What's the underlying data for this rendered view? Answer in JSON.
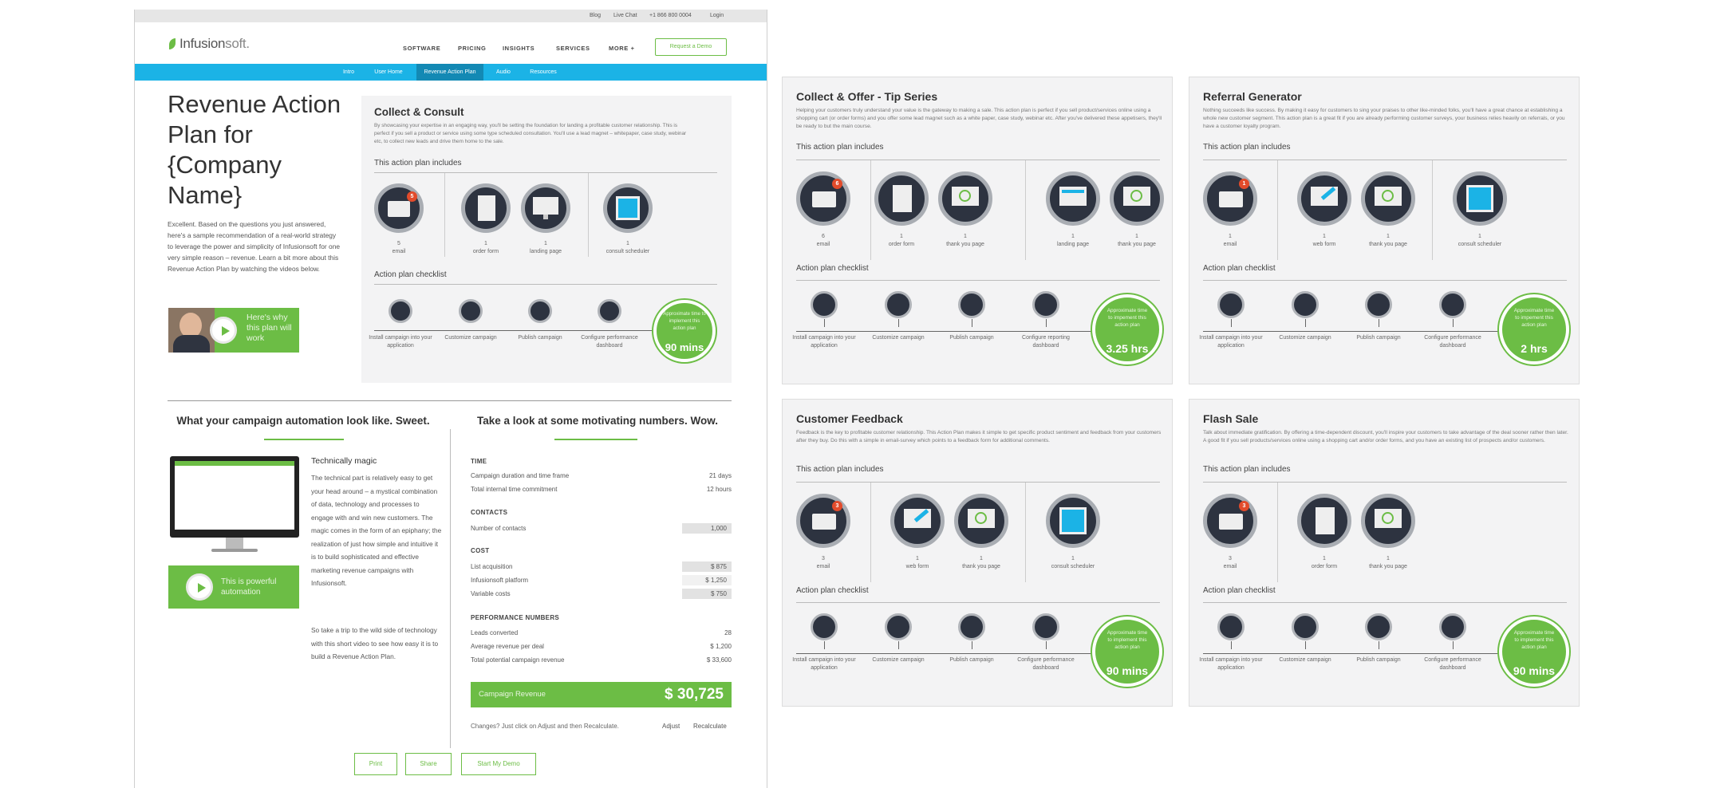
{
  "utility": {
    "blog": "Blog",
    "livechat": "Live Chat",
    "phone": "+1 866 800 0004",
    "login": "Login"
  },
  "brand": {
    "name_a": "Infusion",
    "name_b": "soft."
  },
  "nav": {
    "software": "SOFTWARE",
    "pricing": "PRICING",
    "insights": "INSIGHTS",
    "services": "SERVICES",
    "more": "MORE +",
    "demo": "Request a Demo"
  },
  "subnav": [
    "Intro",
    "User Home",
    "Revenue Action Plan",
    "Audio",
    "Resources"
  ],
  "page": {
    "title": "Revenue Action Plan for {Company Name}",
    "intro": "Excellent. Based on the questions you just answered, here's a sample recommendation of a real-world strategy to leverage the power and simplicity of Infusionsoft for one very simple reason – revenue. Learn a bit more about this Revenue Action Plan by watching the videos below.",
    "video1": "Here's why this plan will work",
    "video2": "This is powerful automation"
  },
  "collect_consult": {
    "title": "Collect & Consult",
    "desc": "By showcasing your expertise in an engaging way, you'll be setting the foundation for landing a profitable customer relationship. This is perfect if you sell a product or service using some type scheduled consultation. You'll use a lead magnet – whitepaper, case study, webinar etc, to collect new leads and drive them home to the sale.",
    "includes": "This action plan includes",
    "items": [
      {
        "count": "5",
        "label": "email",
        "badge": "5"
      },
      {
        "count": "1",
        "label": "order form"
      },
      {
        "count": "1",
        "label": "landing page"
      },
      {
        "count": "1",
        "label": "consult scheduler"
      }
    ],
    "checklist": "Action plan checklist",
    "steps": [
      "Install campaign into your application",
      "Customize campaign",
      "Publish campaign",
      "Configure performance dashboard"
    ],
    "time_label": "Approximate time to implement this action plan",
    "time": "90 mins"
  },
  "automation": {
    "heading": "What your campaign automation look like. Sweet.",
    "subtitle": "Technically magic",
    "p1": "The technical part is relatively easy to get your head around – a mystical combination of data, technology and processes to engage with and win new customers. The magic comes in the form of an epiphany; the realization of just how simple and intuitive it is to build sophisticated and effective marketing revenue campaigns with Infusionsoft.",
    "p2": "So take a trip to the wild side of technology with this short video to see how easy it is to build a Revenue Action Plan."
  },
  "numbers": {
    "heading": "Take a look at some motivating numbers. Wow.",
    "time_h": "TIME",
    "r1": "Campaign duration and time frame",
    "v1": "21 days",
    "r2": "Total internal time commitment",
    "v2": "12 hours",
    "contacts_h": "CONTACTS",
    "r3": "Number of contacts",
    "v3": "1,000",
    "cost_h": "COST",
    "r4": "List acquisition",
    "v4": "$ 875",
    "r5": "Infusionsoft platform",
    "v5": "$ 1,250",
    "r6": "Variable costs",
    "v6": "$ 750",
    "perf_h": "PERFORMANCE NUMBERS",
    "r7": "Leads converted",
    "v7": "28",
    "r8": "Average revenue per deal",
    "v8": "$ 1,200",
    "r9": "Total potential campaign revenue",
    "v9": "$ 33,600",
    "rev_label": "Campaign Revenue",
    "rev_value": "$ 30,725",
    "changes": "Changes? Just click on Adjust and then Recalculate.",
    "adjust": "Adjust",
    "recalc": "Recalculate"
  },
  "buttons": {
    "print": "Print",
    "share": "Share",
    "start": "Start My Demo"
  },
  "cards": [
    {
      "title": "Collect & Offer - Tip Series",
      "desc": "Helping your customers truly understand your value is the gateway to making a sale. This action plan is perfect if you sell product/services online using a shopping cart (or order forms) and you offer some lead magnet such as a white paper, case study, webinar etc. After you've delivered these appetisers, they'll be ready to but the main course.",
      "includes": "This action plan includes",
      "checklist": "Action plan checklist",
      "items": [
        {
          "count": "6",
          "label": "email"
        },
        {
          "count": "1",
          "label": "order form"
        },
        {
          "count": "1",
          "label": "thank you page"
        },
        {
          "count": "1",
          "label": "landing page"
        },
        {
          "count": "1",
          "label": "thank you page"
        }
      ],
      "steps": [
        "Install campaign into your application",
        "Customize campaign",
        "Publish campaign",
        "Configure reporting dashboard"
      ],
      "time_label": "Approximate time to impement this action plan",
      "time": "3.25 hrs"
    },
    {
      "title": "Referral Generator",
      "desc": "Nothing succeeds like success. By making it easy for customers to sing your praises to other like-minded folks, you'll have a great chance at establishing a whole new customer segment. This action plan is a great fit if you are already performing customer surveys, your business relies heavily on referrals, or you have a customer loyalty program.",
      "includes": "This action plan includes",
      "checklist": "Action plan checklist",
      "items": [
        {
          "count": "1",
          "label": "email"
        },
        {
          "count": "1",
          "label": "web form"
        },
        {
          "count": "1",
          "label": "thank you page"
        },
        {
          "count": "1",
          "label": "consult scheduler"
        }
      ],
      "steps": [
        "Install campaign into your application",
        "Customize campaign",
        "Publish campaign",
        "Configure performance dashboard"
      ],
      "time_label": "Approximate time to impement this action plan",
      "time": "2 hrs"
    },
    {
      "title": "Customer Feedback",
      "desc": "Feedback is the key to profitable customer relationship. This Action Plan makes it simple to get specific product sentiment and feedback from your customers after they buy. Do this with a simple in email-survey which points to a feedback form for additional comments.",
      "includes": "This action plan includes",
      "checklist": "Action plan checklist",
      "items": [
        {
          "count": "3",
          "label": "email"
        },
        {
          "count": "1",
          "label": "web form"
        },
        {
          "count": "1",
          "label": "thank you page"
        },
        {
          "count": "1",
          "label": "consult scheduler"
        }
      ],
      "steps": [
        "Install campaign into your application",
        "Customize campaign",
        "Publish campaign",
        "Configure performance dashboard"
      ],
      "time_label": "Approximate time to implement this action plan",
      "time": "90 mins"
    },
    {
      "title": "Flash Sale",
      "desc": "Talk about immediate gratification. By offering a time-dependent discount, you'll inspire your customers to take advantage of the deal sooner rather then later. A good fit if you sell products/services online using a shopping cart and/or order forms, and you have an existing list of prospects and/or customers.",
      "includes": "This action plan includes",
      "checklist": "Action plan checklist",
      "items": [
        {
          "count": "3",
          "label": "email"
        },
        {
          "count": "1",
          "label": "order form"
        },
        {
          "count": "1",
          "label": "thank you page"
        }
      ],
      "steps": [
        "Install campaign into your application",
        "Customize campaign",
        "Publish campaign",
        "Configure performance dashboard"
      ],
      "time_label": "Approximate time to implement this action plan",
      "time": "90 mins"
    }
  ]
}
